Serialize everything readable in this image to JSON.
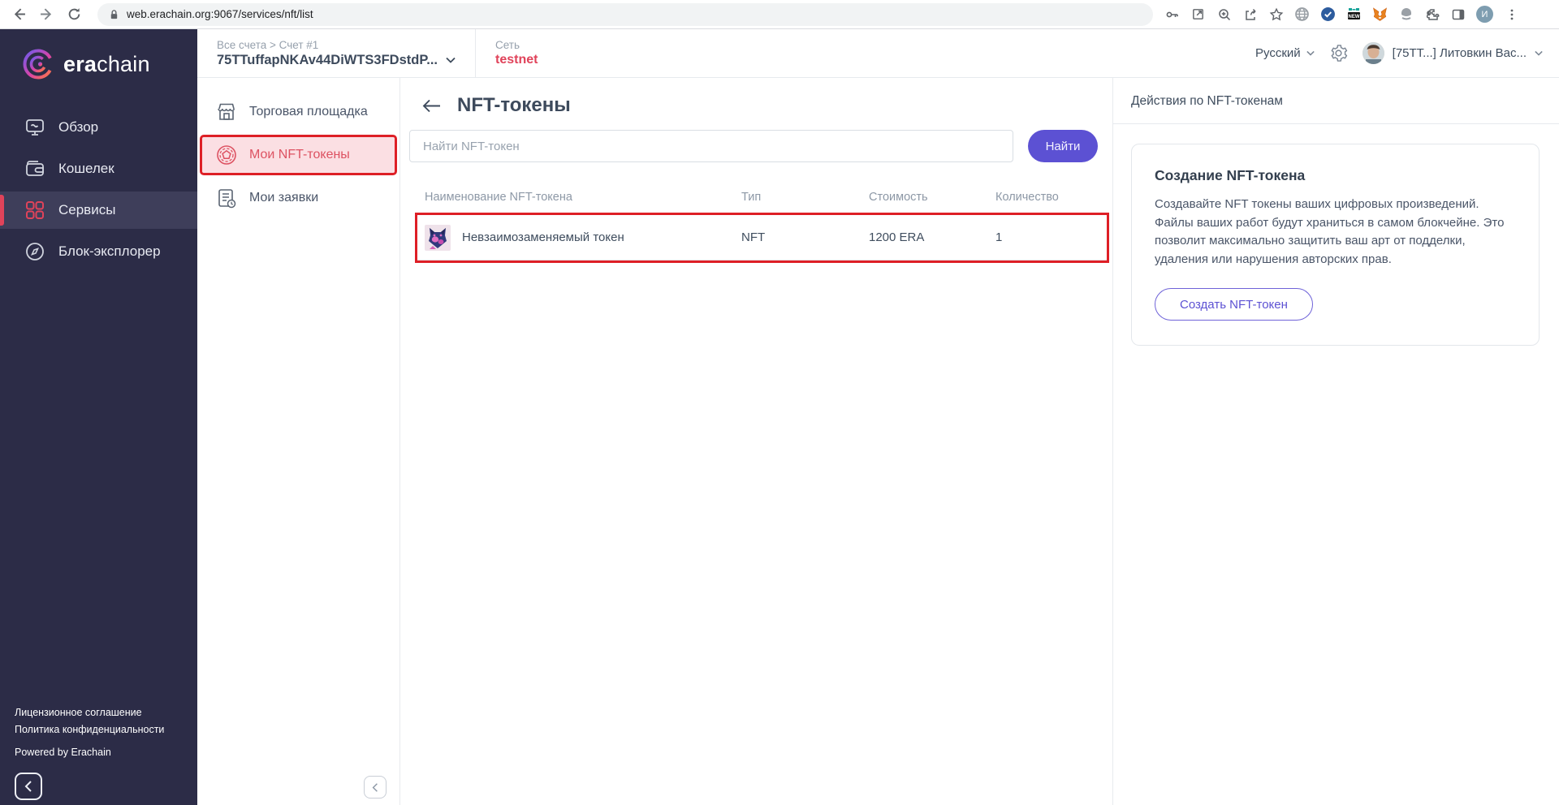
{
  "browser": {
    "url": "web.erachain.org:9067/services/nft/list",
    "profile_initial": "И",
    "new_badge": "NEW"
  },
  "logo": {
    "bold": "era",
    "light": "chain"
  },
  "header": {
    "breadcrumb": "Все счета > Счет #1",
    "account": "75TTuffapNKAv44DiWTS3FDstdP...",
    "network_label": "Сеть",
    "network_value": "testnet",
    "language": "Русский",
    "user": "[75TT...] Литовкин Вас..."
  },
  "sidebar": {
    "items": [
      {
        "label": "Обзор"
      },
      {
        "label": "Кошелек"
      },
      {
        "label": "Сервисы"
      },
      {
        "label": "Блок-эксплорер"
      }
    ],
    "footer_links": [
      {
        "label": "Лицензионное соглашение"
      },
      {
        "label": "Политика конфиденциальности"
      }
    ],
    "powered": "Powered by Erachain",
    "collapse_glyph": "‹"
  },
  "submenu": {
    "items": [
      {
        "label": "Торговая площадка"
      },
      {
        "label": "Мои NFT-токены"
      },
      {
        "label": "Мои заявки"
      }
    ],
    "collapse_glyph": "‹"
  },
  "main": {
    "title": "NFT-токены",
    "search_placeholder": "Найти NFT-токен",
    "search_button": "Найти",
    "table": {
      "headers": [
        "Наименование NFT-токена",
        "Тип",
        "Стоимость",
        "Количество"
      ],
      "rows": [
        {
          "name": "Невзаимозаменяемый токен",
          "type": "NFT",
          "price": "1200 ERA",
          "qty": "1"
        }
      ]
    }
  },
  "aside": {
    "title": "Действия по NFT-токенам",
    "card": {
      "title": "Создание NFT-токена",
      "text": "Создавайте NFT токены ваших цифровых произведений. Файлы ваших работ будут храниться в самом блокчейне. Это позволит максимально защитить ваш арт от подделки, удаления или нарушения авторских прав.",
      "button": "Создать NFT-токен"
    }
  },
  "colors": {
    "sidebar_bg": "#2c2c47",
    "sidebar_active_bg": "#3e3e5a",
    "accent_red": "#e0435a",
    "annotation_red": "#de1f26",
    "primary_purple": "#5c51d3",
    "text_dark": "#3d4a5c",
    "text_gray": "#8d98a6"
  }
}
